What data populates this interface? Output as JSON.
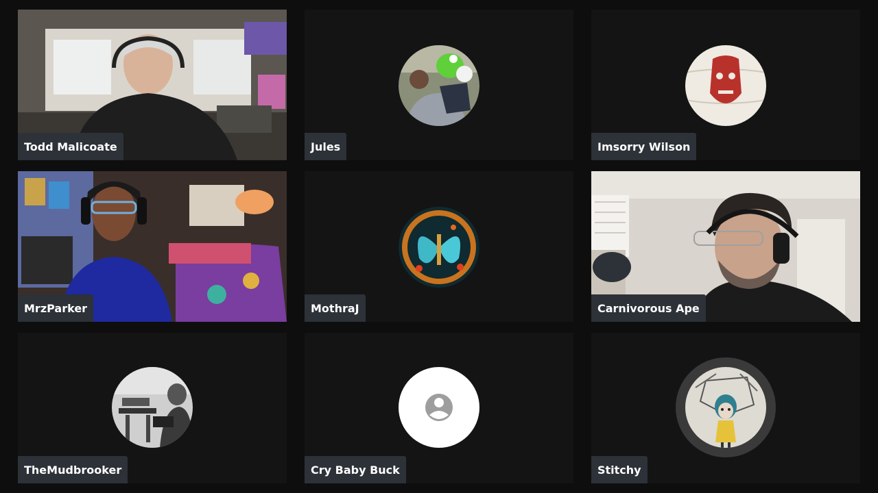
{
  "participants": [
    {
      "name": "Todd Malicoate",
      "type": "video"
    },
    {
      "name": "Jules",
      "type": "avatar"
    },
    {
      "name": "Imsorry Wilson",
      "type": "avatar"
    },
    {
      "name": "MrzParker",
      "type": "video"
    },
    {
      "name": "MothraJ",
      "type": "avatar"
    },
    {
      "name": "Carnivorous Ape",
      "type": "video"
    },
    {
      "name": "TheMudbrooker",
      "type": "avatar"
    },
    {
      "name": "Cry Baby Buck",
      "type": "default-avatar"
    },
    {
      "name": "Stitchy",
      "type": "avatar",
      "speaking": true
    }
  ],
  "colors": {
    "background": "#0e0e0e",
    "tile": "#141414",
    "name_tag": "#2d3138",
    "speaking_ring": "#3a3a3a"
  },
  "icons": {
    "default_avatar": "person-icon"
  }
}
